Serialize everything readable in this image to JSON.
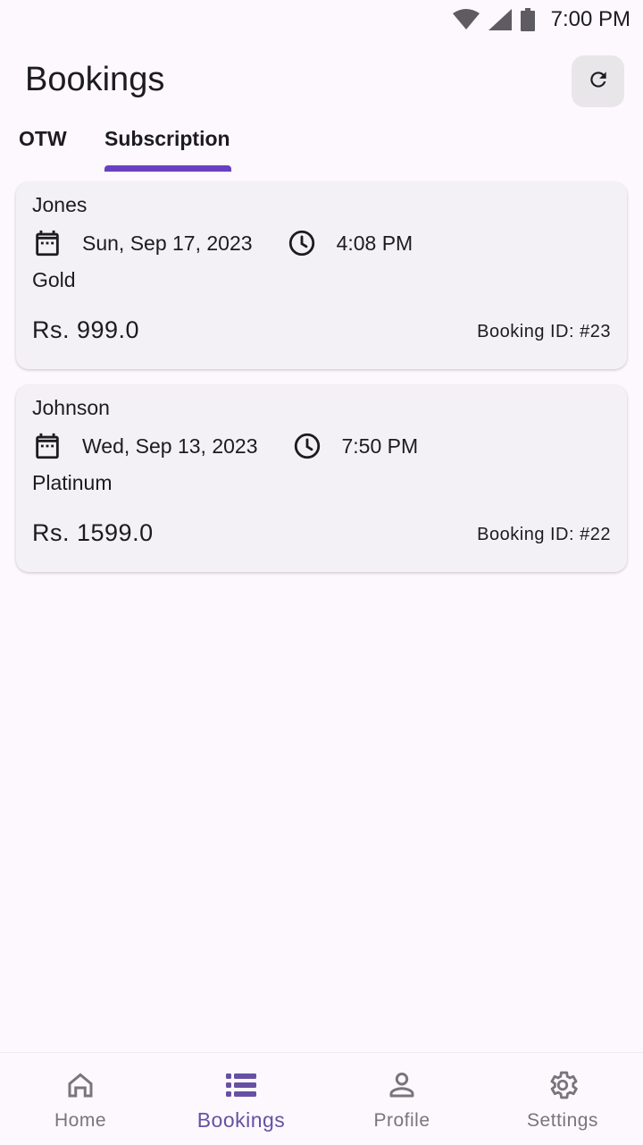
{
  "status_bar": {
    "time": "7:00 PM"
  },
  "header": {
    "title": "Bookings"
  },
  "tabs": [
    {
      "label": "OTW"
    },
    {
      "label": "Subscription"
    }
  ],
  "bookings": [
    {
      "name": "Jones",
      "date": "Sun, Sep 17, 2023",
      "time": "4:08 PM",
      "plan": "Gold",
      "price": "Rs. 999.0",
      "booking_id": "Booking ID: #23"
    },
    {
      "name": "Johnson",
      "date": "Wed, Sep 13, 2023",
      "time": "7:50 PM",
      "plan": "Platinum",
      "price": "Rs. 1599.0",
      "booking_id": "Booking ID: #22"
    }
  ],
  "bottom_nav": [
    {
      "label": "Home",
      "icon": "home-icon"
    },
    {
      "label": "Bookings",
      "icon": "list-icon"
    },
    {
      "label": "Profile",
      "icon": "person-icon"
    },
    {
      "label": "Settings",
      "icon": "gear-icon"
    }
  ],
  "colors": {
    "accent": "#6a3fc1",
    "active_nav": "#6750a4",
    "inactive_nav": "#79747e",
    "card_bg": "#f4f1f6",
    "page_bg": "#fdf8fd"
  }
}
